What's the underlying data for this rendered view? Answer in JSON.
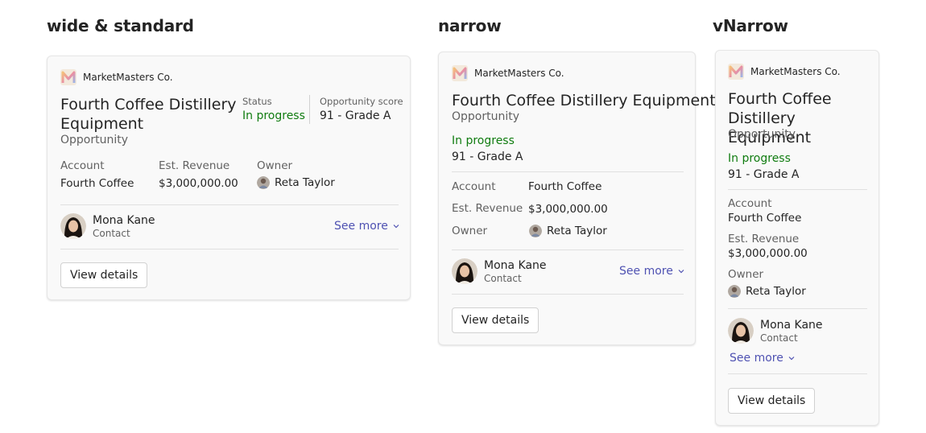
{
  "sections": {
    "wide": "wide & standard",
    "narrow": "narrow",
    "vnarrow": "vNarrow"
  },
  "card": {
    "brand": "MarketMasters Co.",
    "title": "Fourth Coffee Distillery Equipment",
    "title_line1_wide": "Fourth Coffee Distillery",
    "title_line2_wide": "Equipment",
    "title_line1_vnarrow": "Fourth Coffee",
    "title_line2_vnarrow": "Distillery Equipment",
    "subtitle": "Opportunity",
    "status_label": "Status",
    "status_value": "In progress",
    "score_label": "Opportunity score",
    "score_value": "91 - Grade A",
    "account_label": "Account",
    "account_value": "Fourth Coffee",
    "revenue_label": "Est. Revenue",
    "revenue_value": "$3,000,000.00",
    "owner_label": "Owner",
    "owner_value": "Reta Taylor",
    "contact_name": "Mona Kane",
    "contact_role": "Contact",
    "see_more": "See more",
    "view_details": "View details"
  },
  "colors": {
    "status_green": "#107c10",
    "link_purple": "#4f52b2"
  }
}
